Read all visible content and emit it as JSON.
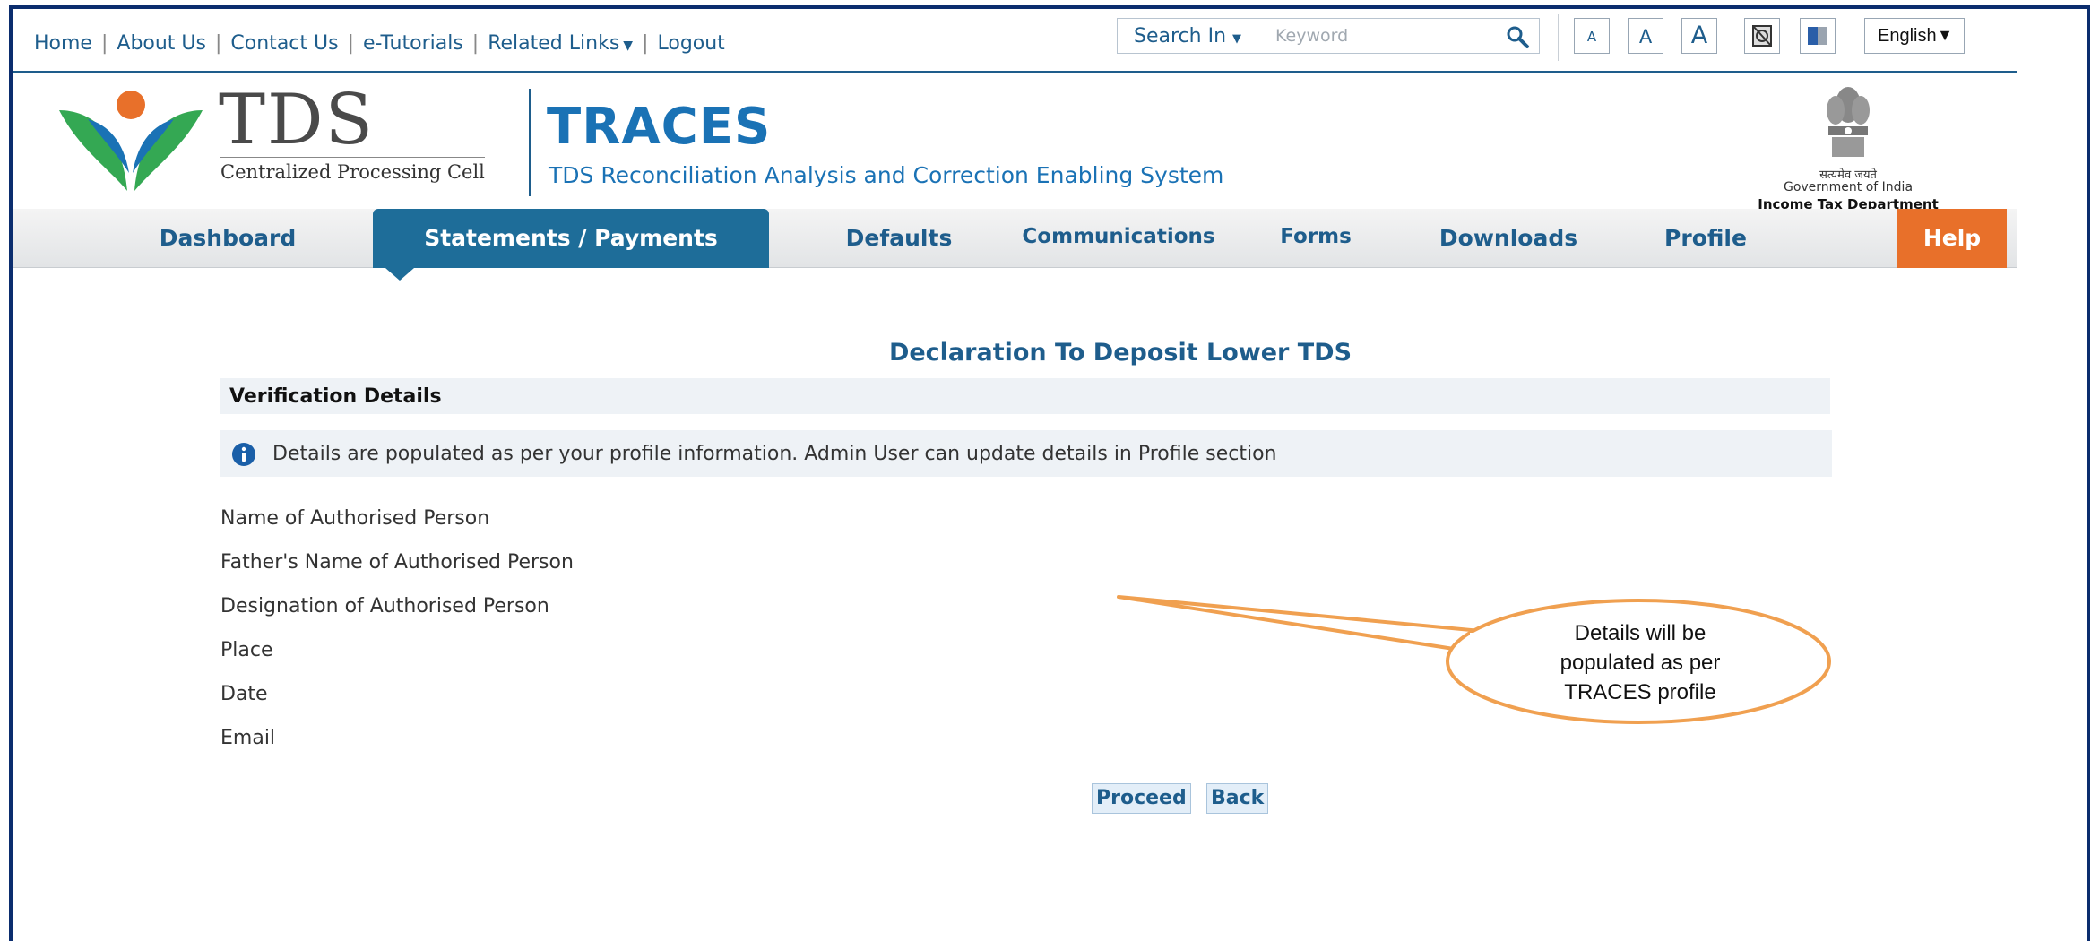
{
  "toplinks": {
    "home": "Home",
    "about": "About Us",
    "contact": "Contact Us",
    "tutorials": "e-Tutorials",
    "related": "Related Links",
    "logout": "Logout"
  },
  "search": {
    "label": "Search In",
    "placeholder": "Keyword"
  },
  "font_controls": [
    "A",
    "A",
    "A"
  ],
  "language": "English",
  "header": {
    "logo_text": "TDS",
    "logo_sub": "Centralized Processing Cell",
    "app_name": "TRACES",
    "app_full_name": "TDS Reconciliation Analysis and Correction Enabling System",
    "gov_motto": "सत्यमेव जयते",
    "gov_name": "Government of India",
    "dept_name": "Income Tax Department"
  },
  "nav": {
    "items": [
      "Dashboard",
      "Statements / Payments",
      "Defaults",
      "Communications",
      "Forms",
      "Downloads",
      "Profile",
      "Help"
    ],
    "active": "Statements / Payments"
  },
  "page": {
    "title": "Declaration To Deposit Lower TDS",
    "section_title": "Verification Details",
    "info_text": "Details are populated as per your profile information. Admin User can update details in Profile section",
    "fields": [
      "Name of Authorised Person",
      "Father's Name of Authorised Person",
      "Designation of Authorised Person",
      "Place",
      "Date",
      "Email"
    ],
    "buttons": {
      "proceed": "Proceed",
      "back": "Back"
    }
  },
  "callout": {
    "lines": [
      "Details will be",
      "populated as per",
      "TRACES profile"
    ],
    "border_color": "#f0a050"
  },
  "colors": {
    "primary": "#1e5d8c",
    "active_tab": "#1e6d99",
    "help": "#e8702a",
    "frame": "#0b2d6e"
  }
}
